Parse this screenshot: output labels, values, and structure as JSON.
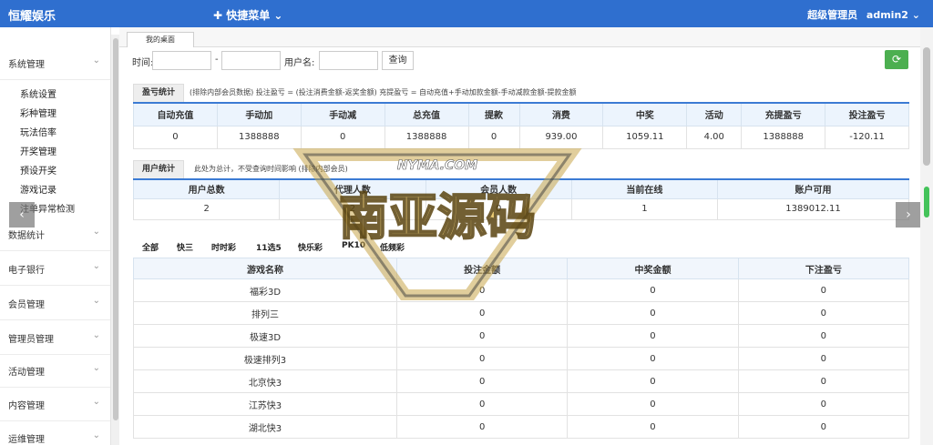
{
  "header": {
    "brand": "恒耀娱乐",
    "quick_menu": "✚ 快捷菜单 ⌄",
    "role": "超级管理员",
    "username": "admin2",
    "caret": "⌄"
  },
  "sidebar": {
    "groups": [
      "系统管理",
      "数据统计",
      "电子银行",
      "会员管理",
      "管理员管理",
      "活动管理",
      "内容管理",
      "运维管理"
    ],
    "items": [
      "系统设置",
      "彩种管理",
      "玩法倍率",
      "开奖管理",
      "预设开奖",
      "游戏记录",
      "注单异常检测"
    ]
  },
  "tabs": [
    "我的桌面"
  ],
  "filter": {
    "time_label": "时间:",
    "dash": "-",
    "username_label": "用户名:",
    "query_button": "查询"
  },
  "profit": {
    "label": "盈亏统计",
    "note": "(排除内部会员数据)  投注盈亏 = (投注消费金额-返奖金额)      充提盈亏 = 自动充值+手动加款金额-手动减款金额-提款金额",
    "headers": [
      "自动充值",
      "手动加",
      "手动减",
      "总充值",
      "提款",
      "消费",
      "中奖",
      "活动",
      "充提盈亏",
      "投注盈亏"
    ],
    "values": [
      "0",
      "1388888",
      "0",
      "1388888",
      "0",
      "939.00",
      "1059.11",
      "4.00",
      "1388888",
      "-120.11"
    ]
  },
  "users": {
    "label": "用户统计",
    "note": "此处为总计，不受查询时间影响 (排除内部会员)",
    "headers": [
      "用户总数",
      "代理人数",
      "会员人数",
      "当前在线",
      "账户可用"
    ],
    "values": [
      "2",
      "2",
      "0",
      "1",
      "1389012.11"
    ]
  },
  "game_tabs": [
    "全部",
    "快三",
    "时时彩",
    "11选5",
    "快乐彩",
    "PK10",
    "低频彩"
  ],
  "games": {
    "headers": [
      "游戏名称",
      "投注金额",
      "中奖金额",
      "下注盈亏"
    ],
    "rows": [
      [
        "福彩3D",
        "0",
        "0",
        "0"
      ],
      [
        "排列三",
        "0",
        "0",
        "0"
      ],
      [
        "极速3D",
        "0",
        "0",
        "0"
      ],
      [
        "极速排列3",
        "0",
        "0",
        "0"
      ],
      [
        "北京快3",
        "0",
        "0",
        "0"
      ],
      [
        "江苏快3",
        "0",
        "0",
        "0"
      ],
      [
        "湖北快3",
        "0",
        "0",
        "0"
      ]
    ]
  },
  "watermark": {
    "top": "NYMA.COM",
    "main": "南亚源码"
  },
  "colors": {
    "topbar": "#2f6fcf",
    "accent": "#3b7bd4",
    "refresh": "#4caf50"
  }
}
